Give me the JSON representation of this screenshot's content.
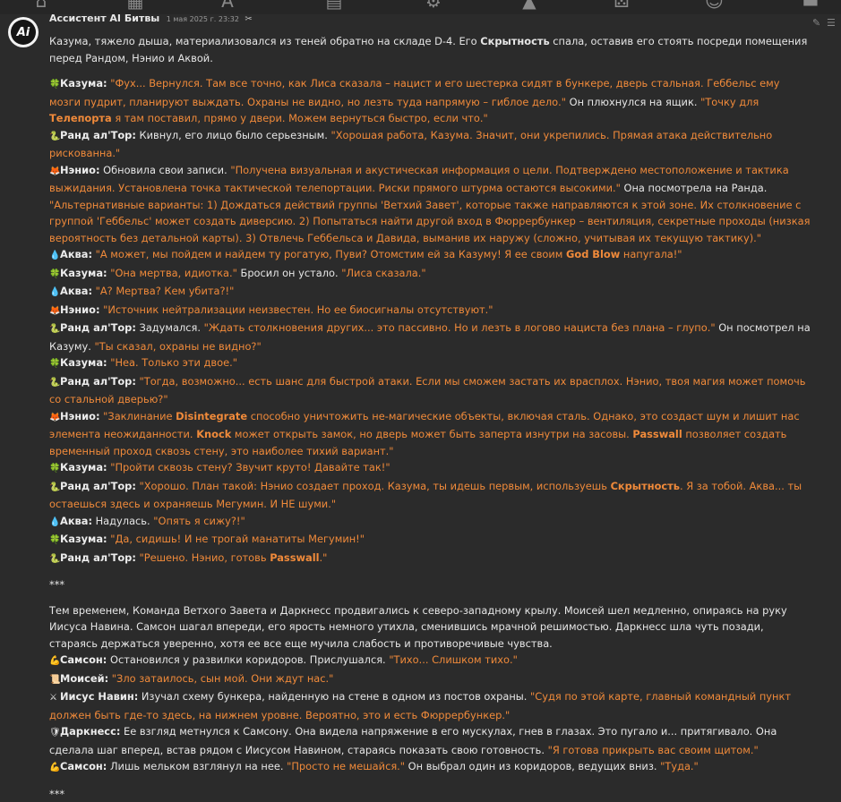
{
  "message": {
    "author": "Ассистент AI Битвы",
    "date": "1 мая 2025 г. 23:32",
    "avatar_text": "Ai"
  },
  "lines": [
    [
      "Казума, тяжело дыша, материализовался из теней обратно на складе D-4. Его ",
      "Скрытность",
      " спала, оставив его стоять посреди помещения перед Рандом, Нэнио и Аквой."
    ],
    [
      "Казума:",
      "\"Фух... Вернулся. Там все точно, как Лиса сказала – нацист и его шестерка сидят в бункере, дверь стальная. Геббельс ему мозги пудрит, планируют выждать. Охраны не видно, но лезть туда напрямую – гиблое дело.\"",
      " Он плюхнулся на ящик. ",
      "\"Точку для ",
      "Телепорта",
      " я там поставил, прямо у двери. Можем вернуться быстро, если что.\""
    ],
    [
      "Ранд ал'Тор:",
      " Кивнул, его лицо было серьезным. ",
      "\"Хорошая работа, Казума. Значит, они укрепились. Прямая атака действительно рискованна.\""
    ],
    [
      "Нэнио:",
      " Обновила свои записи. ",
      "\"Получена визуальная и акустическая информация о цели. Подтверждено местоположение и тактика выжидания. Установлена точка тактической телепортации. Риски прямого штурма остаются высокими.\"",
      " Она посмотрела на Ранда. ",
      "\"Альтернативные варианты: 1) Дождаться действий группы 'Ветхий Завет', которые также направляются к этой зоне. Их столкновение с группой 'Геббельс' может создать диверсию. 2) Попытаться найти другой вход в Фюррербункер – вентиляция, секретные проходы (низкая вероятность без детальной карты). 3) Отвлечь Геббельса и Давида, выманив их наружу (сложно, учитывая их текущую тактику).\""
    ],
    [
      "Аква:",
      "\"А может, мы пойдем и найдем ту рогатую, Пуви? Отомстим ей за Казуму! Я ее своим ",
      "God Blow",
      " напугала!\""
    ],
    [
      "Казума:",
      "\"Она мертва, идиотка.\"",
      " Бросил он устало. ",
      "\"Лиса сказала.\""
    ],
    [
      "Аква:",
      "\"А? Мертва? Кем убита?!\""
    ],
    [
      "Нэнио:",
      "\"Источник нейтрализации неизвестен. Но ее биосигналы отсутствуют.\""
    ],
    [
      "Ранд ал'Тор:",
      " Задумался. ",
      "\"Ждать столкновения других... это пассивно. Но и лезть в логово нациста без плана – глупо.\"",
      " Он посмотрел на Казуму. ",
      "\"Ты сказал, охраны не видно?\""
    ],
    [
      "Казума:",
      "\"Неа. Только эти двое.\""
    ],
    [
      "Ранд ал'Тор:",
      "\"Тогда, возможно... есть шанс для быстрой атаки. Если мы сможем застать их врасплох. Нэнио, твоя магия может помочь со стальной дверью?\""
    ],
    [
      "Нэнио:",
      "\"Заклинание ",
      "Disintegrate",
      " способно уничтожить не-магические объекты, включая сталь. Однако, это создаст шум и лишит нас элемента неожиданности. ",
      "Knock",
      " может открыть замок, но дверь может быть заперта изнутри на засовы. ",
      "Passwall",
      " позволяет создать временный проход сквозь стену, это наиболее тихий вариант.\""
    ],
    [
      "Казума:",
      "\"Пройти сквозь стену? Звучит круто! Давайте так!\""
    ],
    [
      "Ранд ал'Тор:",
      "\"Хорошо. План такой: Нэнио создает проход. Казума, ты идешь первым, используешь ",
      "Скрытность",
      ". Я за тобой. Аква... ты остаешься здесь и охраняешь Мегумин. И НЕ шуми.\""
    ],
    [
      "Аква:",
      " Надулась. ",
      "\"Опять я сижу?!\""
    ],
    [
      "Казума:",
      "\"Да, сидишь! И не трогай манатиты Мегумин!\""
    ],
    [
      "Ранд ал'Тор:",
      "\"Решено. Нэнио, готовь ",
      "Passwall",
      ".\""
    ],
    [
      "***"
    ],
    [
      "Тем временем, Команда Ветхого Завета и Даркнесс продвигались к северо-западному крылу. Моисей шел медленно, опираясь на руку Иисуса Навина. Самсон шагал впереди, его ярость немного утихла, сменившись мрачной решимостью. Даркнесс шла чуть позади, стараясь держаться уверенно, хотя ее все еще мучила слабость и противоречивые чувства."
    ],
    [
      "Самсон:",
      " Остановился у развилки коридоров. Прислушался. ",
      "\"Тихо... Слишком тихо.\""
    ],
    [
      "Моисей:",
      "\"Зло затаилось, сын мой. Они ждут нас.\""
    ],
    [
      "Иисус Навин:",
      " Изучал схему бункера, найденную на стене в одном из постов охраны. ",
      "\"Судя по этой карте, главный командный пункт должен быть где-то здесь, на нижнем уровне. Вероятно, это и есть Фюррербункер.\""
    ],
    [
      "Даркнесс:",
      " Ее взгляд метнулся к Самсону. Она видела напряжение в его мускулах, гнев в глазах. Это пугало и... притягивало. Она сделала шаг вперед, встав рядом с Иисусом Навином, стараясь показать свою готовность. ",
      "\"Я готова прикрыть вас своим щитом.\""
    ],
    [
      "Самсон:",
      " Лишь мельком взглянул на нее. ",
      "\"Просто не мешайся.\"",
      " Он выбрал один из коридоров, ведущих вниз. ",
      "\"Туда.\""
    ],
    [
      "***"
    ]
  ],
  "icons": {
    "kazuma": "clover-icon",
    "rand": "snake-icon",
    "nenio": "fox-icon",
    "aqua": "droplet-icon",
    "samson": "flexed-arm-icon",
    "moses": "scroll-icon",
    "joshua": "crossed-swords-icon",
    "darkness": "shield-icon"
  },
  "colors": {
    "background": "#2b2b2b",
    "text": "#e6e6e6",
    "speech": "#f08a3a"
  }
}
